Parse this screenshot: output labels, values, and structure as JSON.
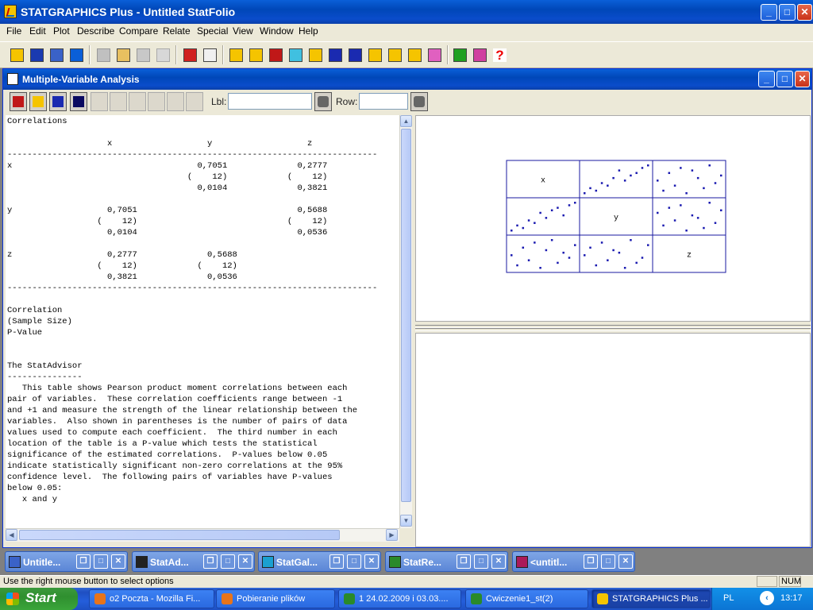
{
  "app": {
    "title": "STATGRAPHICS Plus - Untitled StatFolio"
  },
  "menu": [
    "File",
    "Edit",
    "Plot",
    "Describe",
    "Compare",
    "Relate",
    "Special",
    "View",
    "Window",
    "Help"
  ],
  "toolbar_icons": [
    "open-icon",
    "save-icon",
    "statfolio-icon",
    "datasheet-icon",
    "cut-icon",
    "copy-icon",
    "paste-icon",
    "undo-icon",
    "print-icon",
    "print-preview-icon",
    "scatterplot-icon",
    "boxplot-icon",
    "barchart-icon",
    "xyz-plot-icon",
    "matrix-plot-icon",
    "distribution-icon",
    "normal-plot-icon",
    "timeseries-icon",
    "contour-icon",
    "control-chart-icon",
    "glm-icon",
    "statreporter-icon",
    "stadvisor-icon",
    "help-icon"
  ],
  "analysis": {
    "title": "Multiple-Variable Analysis",
    "lbl_label": "Lbl:",
    "lbl_value": "",
    "row_label": "Row:",
    "row_value": "",
    "output_text": "Correlations\n\n                    x                   y                   z\n--------------------------------------------------------------------------\nx                                     0,7051              0,2777\n                                    (    12)            (    12)\n                                      0,0104              0,3821\n\ny                   0,7051                                0,5688\n                  (    12)                              (    12)\n                    0,0104                                0,0536\n\nz                   0,2777              0,5688\n                  (    12)            (    12)\n                    0,3821              0,0536\n--------------------------------------------------------------------------\n\nCorrelation\n(Sample Size)\nP-Value\n\n\nThe StatAdvisor\n---------------\n   This table shows Pearson product moment correlations between each\npair of variables.  These correlation coefficients range between -1\nand +1 and measure the strength of the linear relationship between the\nvariables.  Also shown in parentheses is the number of pairs of data\nvalues used to compute each coefficient.  The third number in each\nlocation of the table is a P-value which tests the statistical\nsignificance of the estimated correlations.  P-values below 0.05\nindicate statistically significant non-zero correlations at the 95%\nconfidence level.  The following pairs of variables have P-values\nbelow 0.05:\n   x and y"
  },
  "chart_data": {
    "type": "scatter",
    "variables": [
      "x",
      "y",
      "z"
    ],
    "sample_size": 12,
    "correlations": {
      "x-y": 0.7051,
      "x-z": 0.2777,
      "y-z": 0.5688
    },
    "p_values": {
      "x-y": 0.0104,
      "x-z": 0.3821,
      "y-z": 0.0536
    },
    "x": [
      1,
      2,
      3,
      4,
      5,
      6,
      7,
      8,
      9,
      10,
      11,
      12
    ],
    "y": [
      1,
      3,
      2,
      5,
      4,
      8,
      6,
      9,
      10,
      7,
      11,
      12
    ],
    "z": [
      6,
      2,
      9,
      4,
      11,
      1,
      8,
      12,
      3,
      7,
      5,
      10
    ]
  },
  "minimized_windows": [
    {
      "label": "Untitle...",
      "icon": "statfolio-icon",
      "color": "#3a62c8"
    },
    {
      "label": "StatAd...",
      "icon": "stadvisor-icon",
      "color": "#222222"
    },
    {
      "label": "StatGal...",
      "icon": "statgallery-icon",
      "color": "#1aa0d0"
    },
    {
      "label": "StatRe...",
      "icon": "statreporter-icon",
      "color": "#2a8a2a"
    },
    {
      "label": "<untitl...",
      "icon": "datasheet-icon",
      "color": "#aa1a5a"
    }
  ],
  "status": {
    "text": "Use the right mouse button to select options",
    "num": "NUM"
  },
  "taskbar": {
    "start": "Start",
    "tasks": [
      {
        "label": "o2 Poczta - Mozilla Fi...",
        "color": "#e8741a",
        "active": false
      },
      {
        "label": "Pobieranie plików",
        "color": "#e8741a",
        "active": false
      },
      {
        "label": "1 24.02.2009 i 03.03....",
        "color": "#2a8a2a",
        "active": false
      },
      {
        "label": "Cwiczenie1_st(2)",
        "color": "#2a8a2a",
        "active": false
      },
      {
        "label": "STATGRAPHICS Plus ...",
        "color": "#f5c400",
        "active": true
      }
    ],
    "lang": "PL",
    "time": "13:17"
  }
}
